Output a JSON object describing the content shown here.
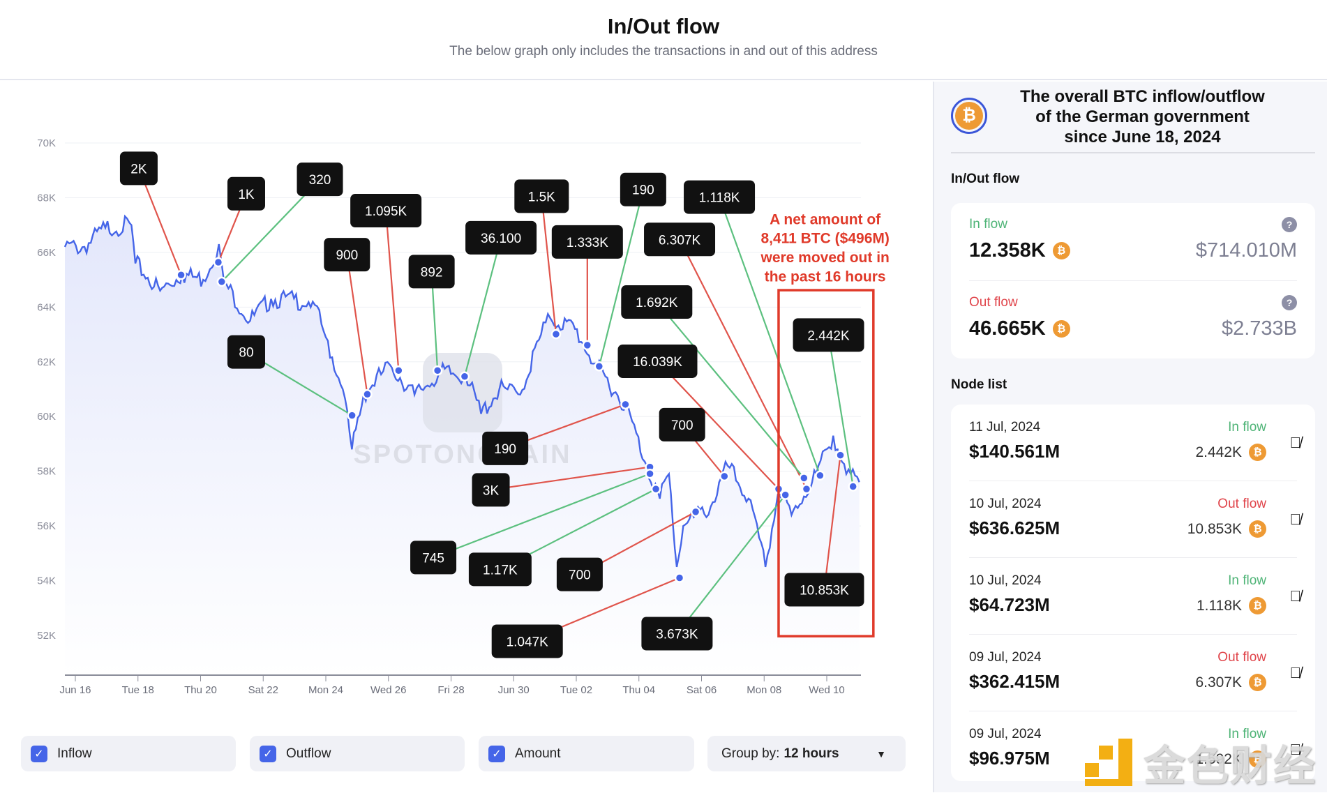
{
  "header": {
    "title": "In/Out flow",
    "subtitle": "The below graph only includes the transactions in and out of this address"
  },
  "chart_data": {
    "type": "line",
    "title": "",
    "xlabel": "",
    "ylabel": "",
    "ylim": [
      51000,
      70500
    ],
    "y_ticks": [
      "70K",
      "68K",
      "66K",
      "64K",
      "62K",
      "60K",
      "58K",
      "56K",
      "54K",
      "52K"
    ],
    "x_ticks": [
      "Jun 16",
      "Tue 18",
      "Thu 20",
      "Sat 22",
      "Mon 24",
      "Wed 26",
      "Fri 28",
      "Jun 30",
      "Tue 02",
      "Thu 04",
      "Sat 06",
      "Mon 08",
      "Wed 10"
    ],
    "grid": "horizontal",
    "series": [
      {
        "points": [
          [
            "2024-06-15T16:00",
            66.2
          ],
          [
            "2024-06-16T07:00",
            66.2
          ],
          [
            "2024-06-16T23:00",
            66.9
          ],
          [
            "2024-06-17T19:00",
            67.0
          ],
          [
            "2024-06-17T22:00",
            65.6
          ],
          [
            "2024-06-18T17:00",
            64.6
          ],
          [
            "2024-06-19T10:00",
            65.2
          ],
          [
            "2024-06-20T02:00",
            65.0
          ],
          [
            "2024-06-20T14:00",
            66.3
          ],
          [
            "2024-06-20T18:00",
            64.9
          ],
          [
            "2024-06-21T14:00",
            63.5
          ],
          [
            "2024-06-22T06:00",
            64.3
          ],
          [
            "2024-06-23T14:00",
            64.2
          ],
          [
            "2024-06-24T00:00",
            62.9
          ],
          [
            "2024-06-24T13:00",
            61.0
          ],
          [
            "2024-06-24T20:00",
            58.8
          ],
          [
            "2024-06-25T05:00",
            60.8
          ],
          [
            "2024-06-26T01:00",
            61.9
          ],
          [
            "2024-06-26T20:00",
            60.8
          ],
          [
            "2024-06-27T16:00",
            61.6
          ],
          [
            "2024-06-28T11:00",
            61.5
          ],
          [
            "2024-06-28T23:00",
            60.1
          ],
          [
            "2024-06-29T13:00",
            61.0
          ],
          [
            "2024-06-30T05:00",
            60.8
          ],
          [
            "2024-06-30T21:00",
            63.0
          ],
          [
            "2024-07-01T04:00",
            63.6
          ],
          [
            "2024-07-01T23:00",
            63.2
          ],
          [
            "2024-07-02T16:00",
            61.8
          ],
          [
            "2024-07-03T14:00",
            60.4
          ],
          [
            "2024-07-04T06:00",
            58.2
          ],
          [
            "2024-07-04T16:00",
            57.0
          ],
          [
            "2024-07-04T23:00",
            57.9
          ],
          [
            "2024-07-05T05:00",
            54.5
          ],
          [
            "2024-07-05T10:00",
            56.0
          ],
          [
            "2024-07-06T07:00",
            56.7
          ],
          [
            "2024-07-06T20:00",
            58.2
          ],
          [
            "2024-07-07T12:00",
            57.0
          ],
          [
            "2024-07-08T01:00",
            54.5
          ],
          [
            "2024-07-08T11:00",
            57.3
          ],
          [
            "2024-07-08T21:00",
            56.4
          ],
          [
            "2024-07-09T16:00",
            57.9
          ],
          [
            "2024-07-10T05:00",
            59.3
          ],
          [
            "2024-07-10T15:00",
            57.9
          ],
          [
            "2024-07-11T01:00",
            57.6
          ]
        ]
      }
    ],
    "annotations": [
      {
        "amount": "2K",
        "type": "outflow"
      },
      {
        "amount": "1K",
        "type": "outflow"
      },
      {
        "amount": "320",
        "type": "inflow"
      },
      {
        "amount": "80",
        "type": "inflow"
      },
      {
        "amount": "900",
        "type": "outflow"
      },
      {
        "amount": "1.095K",
        "type": "outflow"
      },
      {
        "amount": "892",
        "type": "inflow"
      },
      {
        "amount": "36.100",
        "type": "inflow"
      },
      {
        "amount": "1.5K",
        "type": "outflow"
      },
      {
        "amount": "1.333K",
        "type": "outflow"
      },
      {
        "amount": "190",
        "type": "inflow"
      },
      {
        "amount": "1.118K",
        "type": "inflow"
      },
      {
        "amount": "6.307K",
        "type": "outflow"
      },
      {
        "amount": "1.692K",
        "type": "inflow"
      },
      {
        "amount": "16.039K",
        "type": "outflow"
      },
      {
        "amount": "190",
        "type": "outflow"
      },
      {
        "amount": "700",
        "type": "outflow"
      },
      {
        "amount": "3K",
        "type": "outflow"
      },
      {
        "amount": "745",
        "type": "inflow"
      },
      {
        "amount": "1.17K",
        "type": "inflow"
      },
      {
        "amount": "700",
        "type": "outflow"
      },
      {
        "amount": "1.047K",
        "type": "outflow"
      },
      {
        "amount": "3.673K",
        "type": "inflow"
      },
      {
        "amount": "2.442K",
        "type": "inflow"
      },
      {
        "amount": "10.853K",
        "type": "outflow"
      }
    ],
    "callout": [
      "A net amount of",
      "8,411 BTC ($496M)",
      "were moved out in",
      "the past 16 hours"
    ],
    "watermark": "SPOTONCHAIN",
    "colors": {
      "line": "#4565e8",
      "inflow": "#5cc07f",
      "outflow": "#e0544b",
      "callout": "#e03a2a"
    }
  },
  "controls": {
    "inflow": "Inflow",
    "outflow": "Outflow",
    "amount": "Amount",
    "group_label": "Group by:",
    "group_value": "12 hours"
  },
  "sidebar": {
    "title": [
      "The overall BTC inflow/outflow",
      "of the German government",
      "since June 18, 2024"
    ],
    "flow_heading": "In/Out flow",
    "inflow": {
      "label": "In flow",
      "btc": "12.358K",
      "usd": "$714.010M"
    },
    "outflow": {
      "label": "Out flow",
      "btc": "46.665K",
      "usd": "$2.733B"
    },
    "node_heading": "Node list",
    "nodes": [
      {
        "date": "11 Jul, 2024",
        "usd": "$140.561M",
        "type": "In flow",
        "btc": "2.442K"
      },
      {
        "date": "10 Jul, 2024",
        "usd": "$636.625M",
        "type": "Out flow",
        "btc": "10.853K"
      },
      {
        "date": "10 Jul, 2024",
        "usd": "$64.723M",
        "type": "In flow",
        "btc": "1.118K"
      },
      {
        "date": "09 Jul, 2024",
        "usd": "$362.415M",
        "type": "Out flow",
        "btc": "6.307K"
      },
      {
        "date": "09 Jul, 2024",
        "usd": "$96.975M",
        "type": "In flow",
        "btc": "1.592K"
      }
    ]
  },
  "watermark_logo": "金色财经"
}
